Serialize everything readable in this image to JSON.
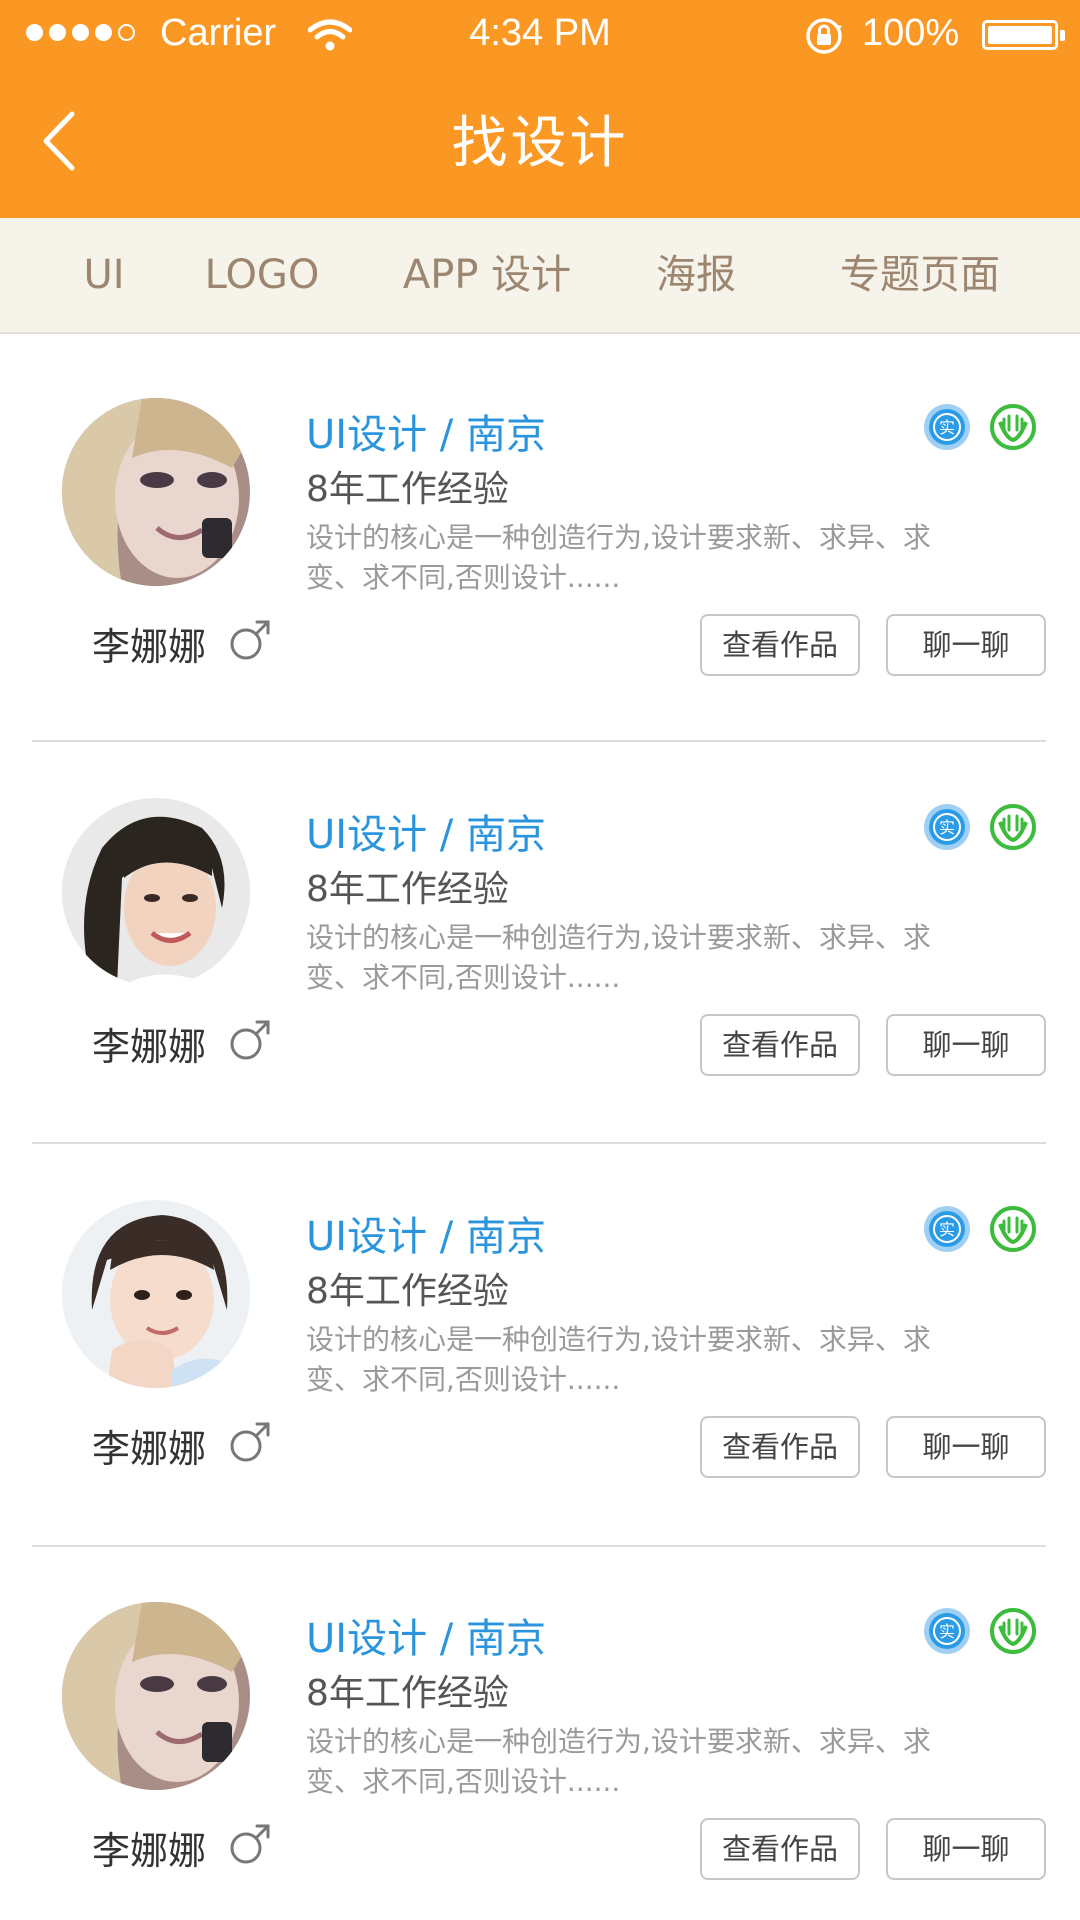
{
  "status_bar": {
    "carrier": "Carrier",
    "time": "4:34 PM",
    "battery": "100%",
    "signal_bars": 4,
    "signal_total": 5
  },
  "nav": {
    "title": "找设计",
    "back_icon": "chevron-left-icon"
  },
  "tabs": [
    {
      "label": "UI"
    },
    {
      "label": "LOGO"
    },
    {
      "label": "APP 设计"
    },
    {
      "label": "海报"
    },
    {
      "label": "专题页面"
    }
  ],
  "designers": [
    {
      "name": "李娜娜",
      "gender_symbol": "♂",
      "role": "UI设计 / 南京",
      "experience": "8年工作经验",
      "description": "设计的核心是一种创造行为,设计要求新、求异、求变、求不同,否则设计......",
      "verified_badge": "实",
      "view_works_label": "查看作品",
      "chat_label": "聊一聊"
    },
    {
      "name": "李娜娜",
      "gender_symbol": "♂",
      "role": "UI设计 / 南京",
      "experience": "8年工作经验",
      "description": "设计的核心是一种创造行为,设计要求新、求异、求变、求不同,否则设计......",
      "verified_badge": "实",
      "view_works_label": "查看作品",
      "chat_label": "聊一聊"
    },
    {
      "name": "李娜娜",
      "gender_symbol": "♂",
      "role": "UI设计 / 南京",
      "experience": "8年工作经验",
      "description": "设计的核心是一种创造行为,设计要求新、求异、求变、求不同,否则设计......",
      "verified_badge": "实",
      "view_works_label": "查看作品",
      "chat_label": "聊一聊"
    },
    {
      "name": "李娜娜",
      "gender_symbol": "♂",
      "role": "UI设计 / 南京",
      "experience": "8年工作经验",
      "description": "设计的核心是一种创造行为,设计要求新、求异、求变、求不同,否则设计......",
      "verified_badge": "实",
      "view_works_label": "查看作品",
      "chat_label": "聊一聊"
    }
  ],
  "colors": {
    "header": "#fb9823",
    "tab_bar": "#f6f3ea",
    "tab_text": "#9d8670",
    "role_text": "#2a95dc",
    "verified_badge": "#2a9be6",
    "green_badge": "#3dbb3d"
  }
}
